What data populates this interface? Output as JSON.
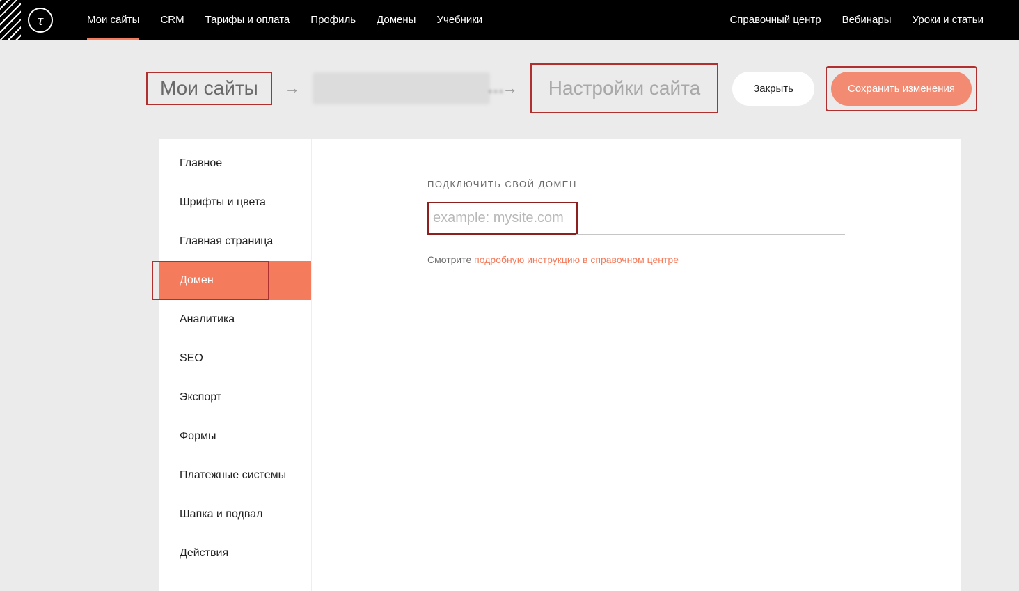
{
  "topnav": {
    "left": [
      {
        "label": "Мои сайты",
        "name": "nav-my-sites",
        "active": true
      },
      {
        "label": "CRM",
        "name": "nav-crm"
      },
      {
        "label": "Тарифы и оплата",
        "name": "nav-pricing"
      },
      {
        "label": "Профиль",
        "name": "nav-profile"
      },
      {
        "label": "Домены",
        "name": "nav-domains"
      },
      {
        "label": "Учебники",
        "name": "nav-tutorials"
      }
    ],
    "right": [
      {
        "label": "Справочный центр",
        "name": "nav-help-center"
      },
      {
        "label": "Вебинары",
        "name": "nav-webinars"
      },
      {
        "label": "Уроки и статьи",
        "name": "nav-lessons"
      }
    ]
  },
  "breadcrumbs": {
    "first": "Мои сайты",
    "third": "Настройки сайта"
  },
  "actions": {
    "close": "Закрыть",
    "save": "Сохранить изменения"
  },
  "sidebar": {
    "items": [
      {
        "label": "Главное",
        "name": "side-main"
      },
      {
        "label": "Шрифты и цвета",
        "name": "side-fonts-colors"
      },
      {
        "label": "Главная страница",
        "name": "side-home-page"
      },
      {
        "label": "Домен",
        "name": "side-domain",
        "active": true
      },
      {
        "label": "Аналитика",
        "name": "side-analytics"
      },
      {
        "label": "SEO",
        "name": "side-seo"
      },
      {
        "label": "Экспорт",
        "name": "side-export"
      },
      {
        "label": "Формы",
        "name": "side-forms"
      },
      {
        "label": "Платежные системы",
        "name": "side-payments"
      },
      {
        "label": "Шапка и подвал",
        "name": "side-header-footer"
      },
      {
        "label": "Действия",
        "name": "side-actions"
      }
    ]
  },
  "main": {
    "field_label": "ПОДКЛЮЧИТЬ СВОЙ ДОМЕН",
    "placeholder": "example: mysite.com",
    "hint_prefix": "Смотрите ",
    "hint_link": "подробную инструкцию в справочном центре"
  }
}
